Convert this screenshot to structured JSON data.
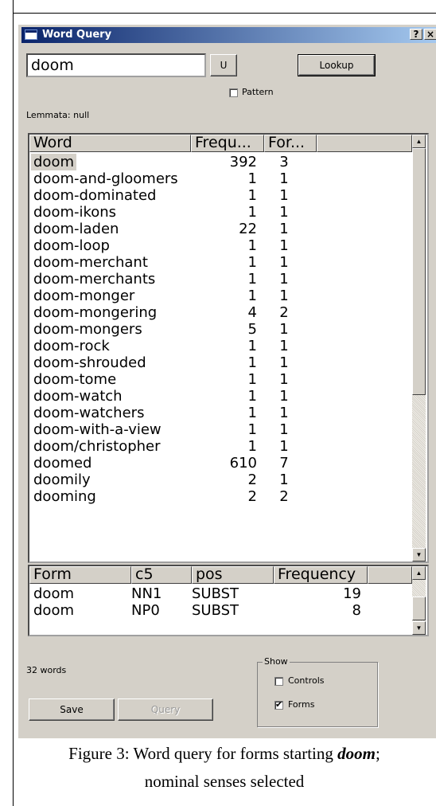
{
  "window": {
    "title": "Word Query",
    "help_button": "?",
    "close_button": "×"
  },
  "query": {
    "input_value": "doom",
    "u_button": "U",
    "lookup_button": "Lookup",
    "pattern_label": "Pattern",
    "pattern_checked": false,
    "lemmata_text": "Lemmata: null"
  },
  "words_table": {
    "columns": [
      "Word",
      "Frequ...",
      "For..."
    ],
    "rows": [
      {
        "word": "doom",
        "frequency": "392",
        "forms": "3",
        "selected": true
      },
      {
        "word": "doom-and-gloomers",
        "frequency": "1",
        "forms": "1"
      },
      {
        "word": "doom-dominated",
        "frequency": "1",
        "forms": "1"
      },
      {
        "word": "doom-ikons",
        "frequency": "1",
        "forms": "1"
      },
      {
        "word": "doom-laden",
        "frequency": "22",
        "forms": "1"
      },
      {
        "word": "doom-loop",
        "frequency": "1",
        "forms": "1"
      },
      {
        "word": "doom-merchant",
        "frequency": "1",
        "forms": "1"
      },
      {
        "word": "doom-merchants",
        "frequency": "1",
        "forms": "1"
      },
      {
        "word": "doom-monger",
        "frequency": "1",
        "forms": "1"
      },
      {
        "word": "doom-mongering",
        "frequency": "4",
        "forms": "2"
      },
      {
        "word": "doom-mongers",
        "frequency": "5",
        "forms": "1"
      },
      {
        "word": "doom-rock",
        "frequency": "1",
        "forms": "1"
      },
      {
        "word": "doom-shrouded",
        "frequency": "1",
        "forms": "1"
      },
      {
        "word": "doom-tome",
        "frequency": "1",
        "forms": "1"
      },
      {
        "word": "doom-watch",
        "frequency": "1",
        "forms": "1"
      },
      {
        "word": "doom-watchers",
        "frequency": "1",
        "forms": "1"
      },
      {
        "word": "doom-with-a-view",
        "frequency": "1",
        "forms": "1"
      },
      {
        "word": "doom/christopher",
        "frequency": "1",
        "forms": "1"
      },
      {
        "word": "doomed",
        "frequency": "610",
        "forms": "7"
      },
      {
        "word": "doomily",
        "frequency": "2",
        "forms": "1"
      },
      {
        "word": "dooming",
        "frequency": "2",
        "forms": "2"
      }
    ]
  },
  "forms_table": {
    "columns": [
      "Form",
      "c5",
      "pos",
      "Frequency"
    ],
    "rows": [
      {
        "form": "doom",
        "c5": "NN1",
        "pos": "SUBST",
        "frequency": "19"
      },
      {
        "form": "doom",
        "c5": "NP0",
        "pos": "SUBST",
        "frequency": "8"
      }
    ]
  },
  "footer": {
    "word_count": "32 words",
    "save_button": "Save",
    "query_button": "Query",
    "show_group_label": "Show",
    "controls_label": "Controls",
    "controls_checked": false,
    "forms_label": "Forms",
    "forms_checked": true
  },
  "caption": {
    "prefix": "Figure 3: Word query for forms starting ",
    "emphasis": "doom",
    "suffix": ";",
    "line2": "nominal senses selected"
  }
}
